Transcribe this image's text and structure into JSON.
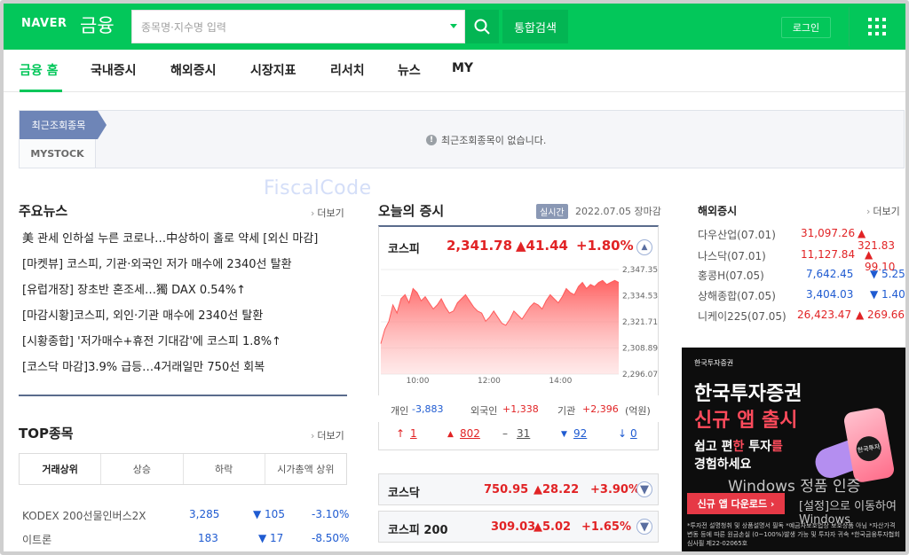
{
  "header": {
    "logo": "NAVER",
    "logo_sub": "금융",
    "search_placeholder": "종목명·지수명 입력",
    "total_search": "통합검색",
    "login": "로그인"
  },
  "nav": {
    "items": [
      "금융 홈",
      "국내증시",
      "해외증시",
      "시장지표",
      "리서치",
      "뉴스",
      "MY"
    ]
  },
  "recent": {
    "tab_label": "최근조회종목",
    "mystock_label": "MYSTOCK",
    "empty_message": "최근조회종목이 없습니다."
  },
  "watermark": "FiscalCode",
  "main_news": {
    "title": "주요뉴스",
    "more": "더보기",
    "items": [
      "美 관세 인하설 누른 코로나…中상하이 홀로 약세 [외신 마감]",
      "[마켓뷰] 코스피, 기관·외국인 저가 매수에 2340선 탈환",
      "[유럽개장] 장초반 혼조세…獨 DAX 0.54%↑",
      "[마감시황]코스피, 외인·기관 매수에 2340선 탈환",
      "[시황종합] '저가매수+휴전 기대감'에 코스피 1.8%↑",
      "[코스닥 마감]3.9% 급등…4거래일만 750선 회복"
    ]
  },
  "top_stocks": {
    "title": "TOP종목",
    "more": "더보기",
    "tabs": [
      "거래상위",
      "상승",
      "하락",
      "시가총액 상위"
    ],
    "rows": [
      {
        "name": "KODEX 200선물인버스2X",
        "price": "3,285",
        "change": "▼ 105",
        "rate": "-3.10%"
      },
      {
        "name": "이트론",
        "price": "183",
        "change": "▼ 17",
        "rate": "-8.50%"
      }
    ]
  },
  "today_market": {
    "title": "오늘의 증시",
    "realtime": "실시간",
    "date": "2022.07.05 장마감",
    "kospi": {
      "name": "코스피",
      "value": "2,341.78",
      "change": "▲41.44",
      "rate": "+1.80%"
    },
    "investors": {
      "individual_label": "개인",
      "individual": "-3,883",
      "foreign_label": "외국인",
      "foreign": "+1,338",
      "inst_label": "기관",
      "inst": "+2,396",
      "unit": "(억원)"
    },
    "advance": {
      "upper": "1",
      "up": "802",
      "flat": "31",
      "down": "92",
      "lower": "0"
    },
    "kosdaq": {
      "name": "코스닥",
      "value": "750.95",
      "change": "▲28.22",
      "rate": "+3.90%"
    },
    "kospi200": {
      "name": "코스피 200",
      "value": "309.03",
      "change": "▲5.02",
      "rate": "+1.65%"
    }
  },
  "chart_data": {
    "type": "area",
    "title": "",
    "xlabel": "",
    "ylabel": "",
    "x_ticks": [
      "10:00",
      "12:00",
      "14:00"
    ],
    "y_ticks": [
      "2,347.35",
      "2,334.53",
      "2,321.71",
      "2,308.89",
      "2,296.07"
    ],
    "ylim": [
      2296.07,
      2347.35
    ],
    "series": [
      {
        "values": [
          2311,
          2318,
          2322,
          2330,
          2326,
          2333,
          2335,
          2331,
          2338,
          2336,
          2332,
          2334,
          2331,
          2328,
          2330,
          2333,
          2329,
          2326,
          2327,
          2331,
          2333,
          2335,
          2332,
          2329,
          2327,
          2326,
          2322,
          2324,
          2327,
          2324,
          2321,
          2320,
          2323,
          2327,
          2325,
          2323,
          2326,
          2329,
          2331,
          2330,
          2328,
          2332,
          2335,
          2333,
          2331,
          2334,
          2338,
          2336,
          2335,
          2339,
          2341,
          2338,
          2340,
          2339,
          2341,
          2342,
          2340,
          2341,
          2342,
          2341
        ]
      }
    ],
    "color": "#ff5a5a"
  },
  "overseas": {
    "title": "해외증시",
    "more": "더보기",
    "rows": [
      {
        "name": "다우산업(07.01)",
        "value": "31,097.26",
        "change": "▲ 321.83",
        "dir": "up"
      },
      {
        "name": "나스닥(07.01)",
        "value": "11,127.84",
        "change": "▲ 99.10",
        "dir": "up"
      },
      {
        "name": "홍콩H(07.05)",
        "value": "7,642.45",
        "change": "▼ 5.25",
        "dir": "down"
      },
      {
        "name": "상해종합(07.05)",
        "value": "3,404.03",
        "change": "▼ 1.40",
        "dir": "down"
      },
      {
        "name": "니케이225(07.05)",
        "value": "26,423.47",
        "change": "▲ 269.66",
        "dir": "up"
      }
    ]
  },
  "ad": {
    "logo": "한국투자증권",
    "line1": "한국투자증권",
    "line2": "신규 앱 출시",
    "line3a": "쉽고 편",
    "line3b": "한",
    "line3c": " 투자",
    "line3d": "를",
    "line4": "경험하세요",
    "button": "신규 앱 다운로드 ›",
    "fine": "*투자전 설명청취 및 상품설명서 필독 *예금자보호법상 보호상품 아님 *자산가격변동 등에 따른 원금손실 (0~100%)발생 가능 및 투자자 귀속 *한국금융투자협회 심사필 제22-02065호",
    "phone_label": "한국투자"
  },
  "windows": {
    "line1": "Windows 정품 인증",
    "line2": "[설정]으로 이동하여 Windows"
  }
}
